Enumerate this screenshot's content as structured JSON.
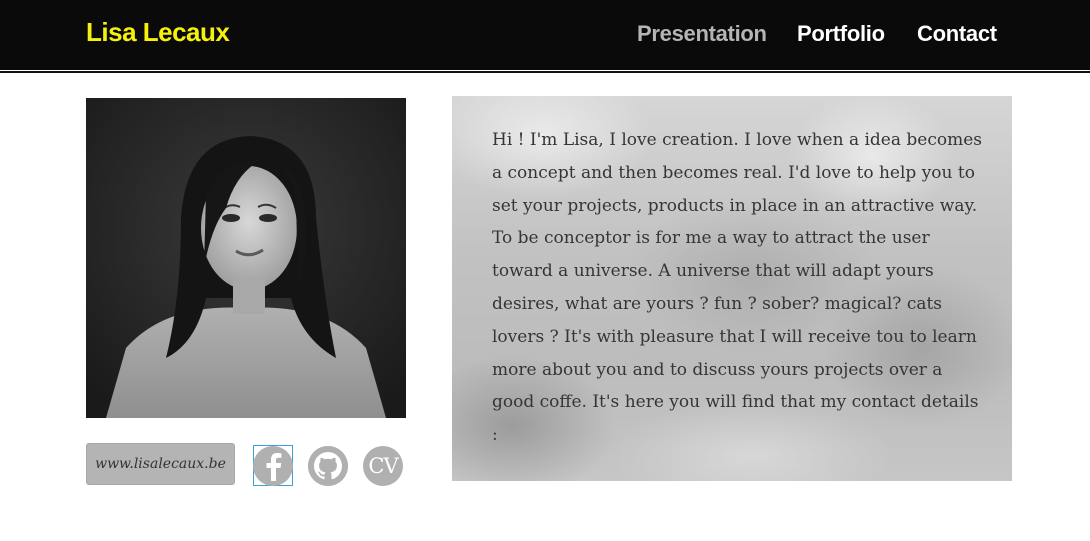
{
  "header": {
    "brand": "Lisa Lecaux",
    "nav": [
      {
        "label": "Presentation",
        "active": true
      },
      {
        "label": "Portfolio",
        "active": false
      },
      {
        "label": "Contact",
        "active": false
      }
    ],
    "colors": {
      "background": "#0a0a0a",
      "brand": "#f5f10c",
      "active_link": "#b5b5b5",
      "link": "#ffffff"
    }
  },
  "profile": {
    "photo_icon": "portrait-photo",
    "website_label": "www.lisalecaux.be",
    "social": [
      {
        "name": "facebook-icon",
        "glyph": "f"
      },
      {
        "name": "github-icon",
        "glyph": ""
      },
      {
        "name": "cv-icon",
        "glyph": "CV"
      }
    ]
  },
  "about": {
    "text": "Hi ! I'm Lisa, I love creation. I love when a idea becomes a concept and then becomes real. I'd love to help you to set your projects, products in place in an attractive way. To be conceptor is for me a way to attract the user toward a universe. A universe that will adapt yours desires, what are yours ? fun ? sober? magical? cats lovers ? It's with pleasure that I will receive tou to learn more about you and to discuss yours projects over a good coffe. It's here you will find that my contact details :"
  }
}
